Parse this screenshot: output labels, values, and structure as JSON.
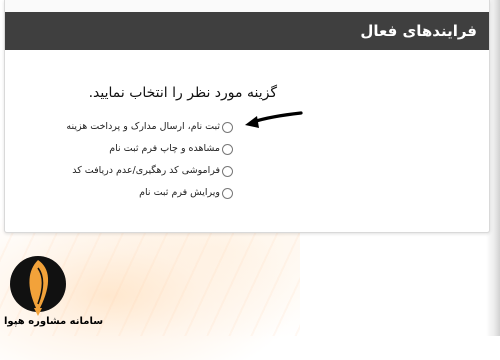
{
  "header": {
    "title": "فرایندهای فعال"
  },
  "main": {
    "prompt": "گزینه مورد نظر را انتخاب نمایید.",
    "options": [
      {
        "label": "ثبت نام، ارسال مدارک و پرداخت هزینه"
      },
      {
        "label": "مشاهده و چاپ فرم ثبت نام"
      },
      {
        "label": "فراموشی کد رهگیری/عدم دریافت کد"
      },
      {
        "label": "ویرایش فرم ثبت نام"
      }
    ]
  },
  "watermark": {
    "text": "سامانه مشاوره هپوا"
  },
  "colors": {
    "header_bg": "#3f3f3f",
    "header_text": "#ffffff",
    "arrow": "#000000"
  }
}
